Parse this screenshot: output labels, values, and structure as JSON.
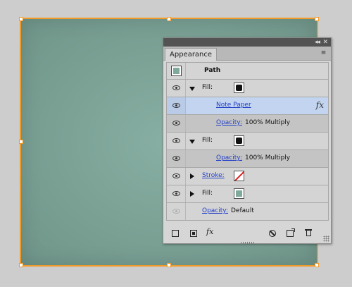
{
  "panel": {
    "tab_label": "Appearance",
    "collapse_glyph": "◂◂",
    "close_glyph": "✕",
    "menu_glyph": "≡"
  },
  "rows": {
    "path_label": "Path",
    "fill1_label": "Fill:",
    "note_paper_label": "Note Paper",
    "fx_label": "fx",
    "opacity1_label": "Opacity:",
    "opacity1_value": "100% Multiply",
    "fill2_label": "Fill:",
    "opacity2_label": "Opacity:",
    "opacity2_value": "100% Multiply",
    "stroke_label": "Stroke:",
    "fill3_label": "Fill:",
    "opacity3_label": "Opacity:",
    "opacity3_value": "Default"
  },
  "toolbar": {
    "fx_label": "fx"
  },
  "colors": {
    "object_fill": "#7fa99c",
    "selection": "#f09a2a",
    "selected_row": "#c2d4ef",
    "link": "#2340c8"
  },
  "icons": [
    "eye-icon",
    "disclosure-triangle-icon",
    "fx-icon",
    "new-stroke-icon",
    "new-fill-icon",
    "clear-appearance-icon",
    "duplicate-item-icon",
    "delete-item-icon"
  ]
}
